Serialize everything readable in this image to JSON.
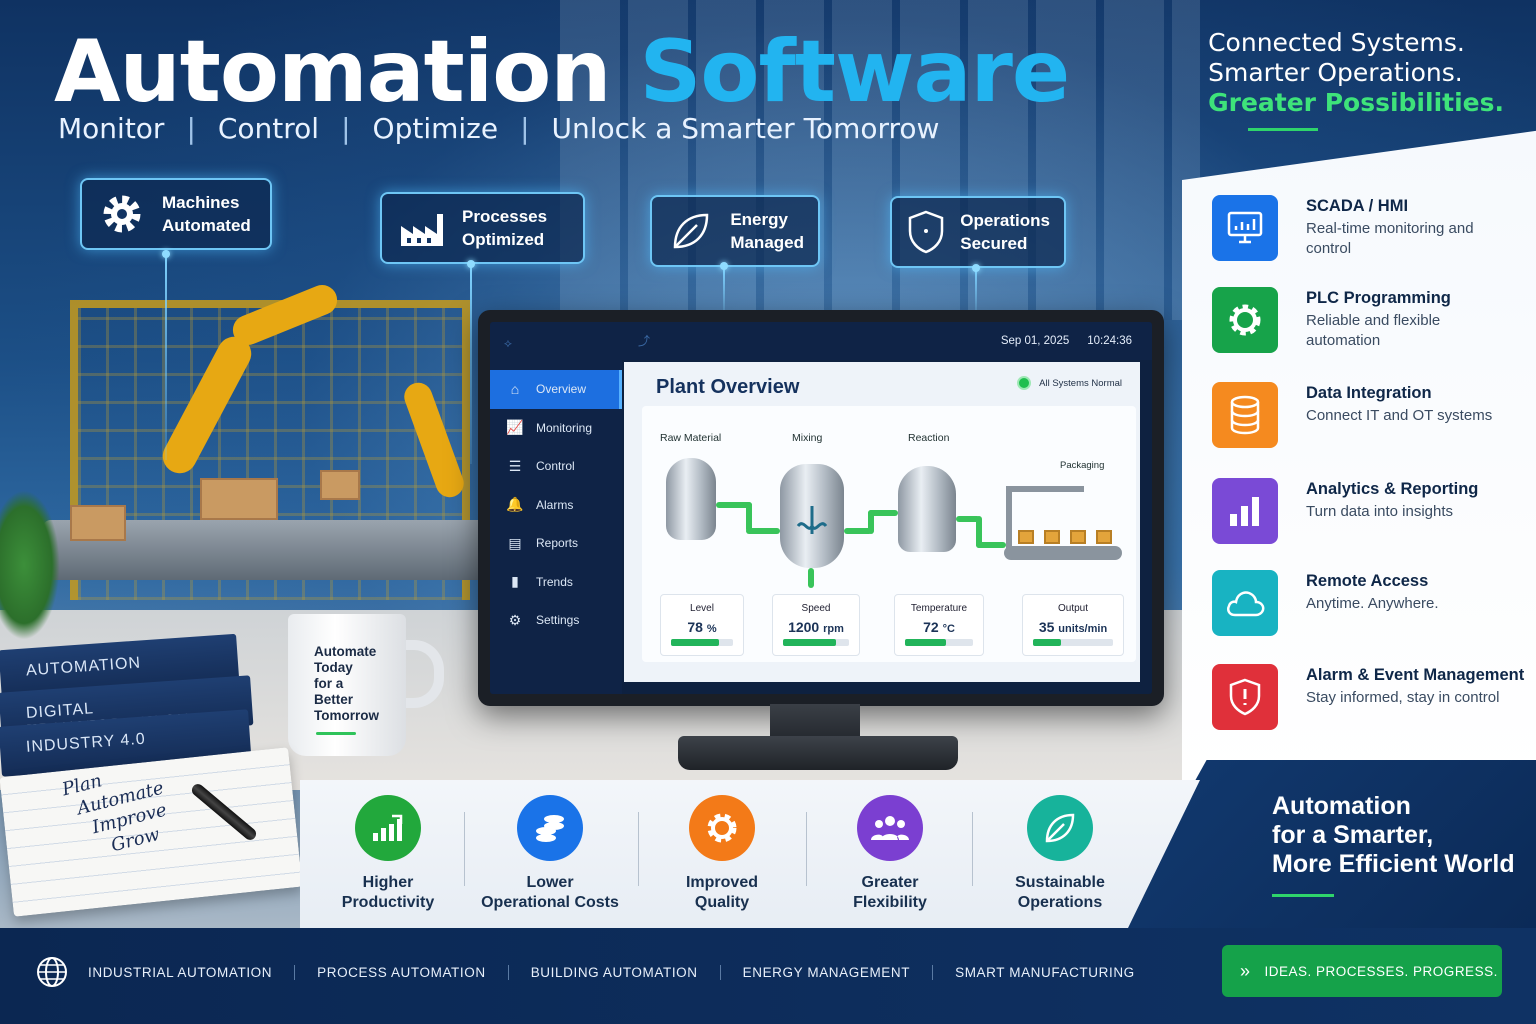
{
  "header": {
    "title_part1": "Automation",
    "title_part2": "Software",
    "subtitle_items": [
      "Monitor",
      "Control",
      "Optimize",
      "Unlock a Smarter Tomorrow"
    ],
    "subtitle_separator": "|"
  },
  "tagline": {
    "line1": "Connected Systems.",
    "line2": "Smarter Operations.",
    "line3": "Greater Possibilities."
  },
  "callouts": [
    {
      "line1": "Machines",
      "line2": "Automated",
      "icon": "gear-icon"
    },
    {
      "line1": "Processes",
      "line2": "Optimized",
      "icon": "factory-icon"
    },
    {
      "line1": "Energy",
      "line2": "Managed",
      "icon": "leaf-icon"
    },
    {
      "line1": "Operations",
      "line2": "Secured",
      "icon": "shield-icon"
    }
  ],
  "dashboard": {
    "date": "Sep 01, 2025",
    "time": "10:24:36",
    "title": "Plant Overview",
    "status": "All Systems Normal",
    "nav": [
      {
        "label": "Overview",
        "icon": "home-icon",
        "active": true
      },
      {
        "label": "Monitoring",
        "icon": "chart-icon",
        "active": false
      },
      {
        "label": "Control",
        "icon": "sliders-icon",
        "active": false
      },
      {
        "label": "Alarms",
        "icon": "bell-icon",
        "active": false
      },
      {
        "label": "Reports",
        "icon": "document-icon",
        "active": false
      },
      {
        "label": "Trends",
        "icon": "bars-icon",
        "active": false
      },
      {
        "label": "Settings",
        "icon": "gear-icon",
        "active": false
      }
    ],
    "stages": [
      "Raw Material",
      "Mixing",
      "Reaction",
      "Packaging"
    ],
    "metrics": [
      {
        "label": "Level",
        "value": "78",
        "unit": "%",
        "fill": 0.78
      },
      {
        "label": "Speed",
        "value": "1200",
        "unit": "rpm",
        "fill": 0.8
      },
      {
        "label": "Temperature",
        "value": "72",
        "unit": "°C",
        "fill": 0.6
      },
      {
        "label": "Output",
        "value": "35",
        "unit": "units/min",
        "fill": 0.35
      }
    ]
  },
  "solutions": [
    {
      "title": "SCADA / HMI",
      "desc": "Real-time monitoring and control",
      "color": "#1a73e8",
      "icon": "monitor-chart-icon"
    },
    {
      "title": "PLC Programming",
      "desc": "Reliable and flexible automation",
      "color": "#17a34a",
      "icon": "gear-icon"
    },
    {
      "title": "Data Integration",
      "desc": "Connect IT and OT systems",
      "color": "#f58a1f",
      "icon": "database-icon"
    },
    {
      "title": "Analytics & Reporting",
      "desc": "Turn data into insights",
      "color": "#7a4ad6",
      "icon": "bar-chart-icon"
    },
    {
      "title": "Remote Access",
      "desc": "Anytime. Anywhere.",
      "color": "#18b3c2",
      "icon": "cloud-icon"
    },
    {
      "title": "Alarm & Event Management",
      "desc": "Stay informed, stay in control",
      "color": "#e0303a",
      "icon": "shield-alert-icon"
    }
  ],
  "closing": {
    "line1": "Automation",
    "line2": "for a Smarter,",
    "line3": "More Efficient World"
  },
  "benefits": [
    {
      "line1": "Higher",
      "line2": "Productivity",
      "color": "#22a83c",
      "icon": "growth-chart-icon"
    },
    {
      "line1": "Lower",
      "line2": "Operational Costs",
      "color": "#1a73e8",
      "icon": "coins-icon"
    },
    {
      "line1": "Improved",
      "line2": "Quality",
      "color": "#f37a18",
      "icon": "gear-icon"
    },
    {
      "line1": "Greater",
      "line2": "Flexibility",
      "color": "#7b3fd1",
      "icon": "team-icon"
    },
    {
      "line1": "Sustainable",
      "line2": "Operations",
      "color": "#17b39b",
      "icon": "leaf-icon"
    }
  ],
  "desk": {
    "books": [
      "AUTOMATION",
      "DIGITAL TRANSFORMATION",
      "INDUSTRY 4.0"
    ],
    "mug": [
      "Automate",
      "Today",
      "for a",
      "Better",
      "Tomorrow"
    ],
    "notebook": [
      "Plan",
      "Automate",
      "Improve",
      "Grow"
    ]
  },
  "footer": {
    "nav": [
      "INDUSTRIAL AUTOMATION",
      "PROCESS AUTOMATION",
      "BUILDING AUTOMATION",
      "ENERGY MANAGEMENT",
      "SMART MANUFACTURING"
    ],
    "cta": "IDEAS. PROCESSES. PROGRESS."
  }
}
